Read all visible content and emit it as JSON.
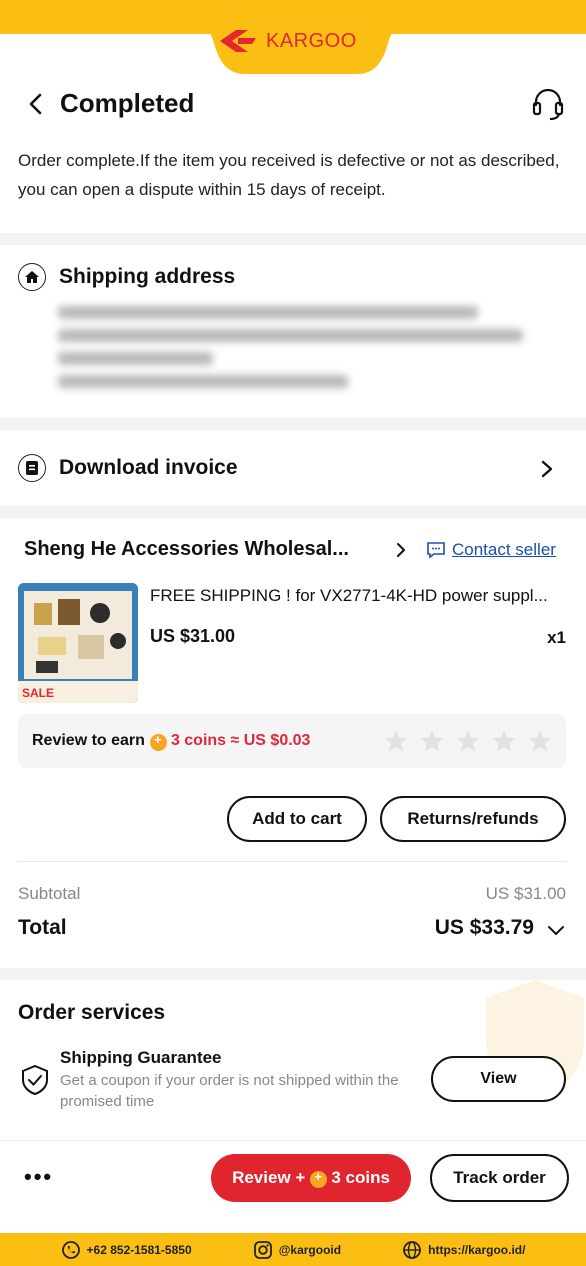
{
  "brand": {
    "name": "KARGOO",
    "color": "#e3262f",
    "band_color": "#fbbf14"
  },
  "header": {
    "title": "Completed",
    "back_icon": "back-arrow-icon",
    "support_icon": "headset-icon"
  },
  "notice": "Order complete.If the item you received is defective or not as described, you can open a dispute within 15 days of receipt.",
  "shipping": {
    "title": "Shipping address",
    "icon": "home-icon"
  },
  "invoice": {
    "title": "Download invoice",
    "icon": "document-icon"
  },
  "store": {
    "name": "Sheng He Accessories Wholesal...",
    "contact_label": "Contact seller"
  },
  "product": {
    "title": "FREE SHIPPING ! for VX2771-4K-HD power suppl...",
    "price": "US $31.00",
    "quantity": "x1"
  },
  "review": {
    "earn_label": "Review to earn",
    "coins_label": "3 coins ≈ US $0.03",
    "stars": 5
  },
  "actions": {
    "add_to_cart": "Add to cart",
    "returns": "Returns/refunds"
  },
  "summary": {
    "subtotal_label": "Subtotal",
    "subtotal_value": "US $31.00",
    "total_label": "Total",
    "total_value": "US $33.79"
  },
  "services": {
    "title": "Order services",
    "guarantee_title": "Shipping Guarantee",
    "guarantee_desc": "Get a coupon if your order is not shipped within the promised time",
    "view_label": "View"
  },
  "bottom": {
    "more_label": "•••",
    "review_prefix": "Review +",
    "review_coins": "3 coins",
    "track_label": "Track order"
  },
  "footer": {
    "phone": "+62 852-1581-5850",
    "instagram": "@kargooid",
    "website": "https://kargoo.id/"
  }
}
